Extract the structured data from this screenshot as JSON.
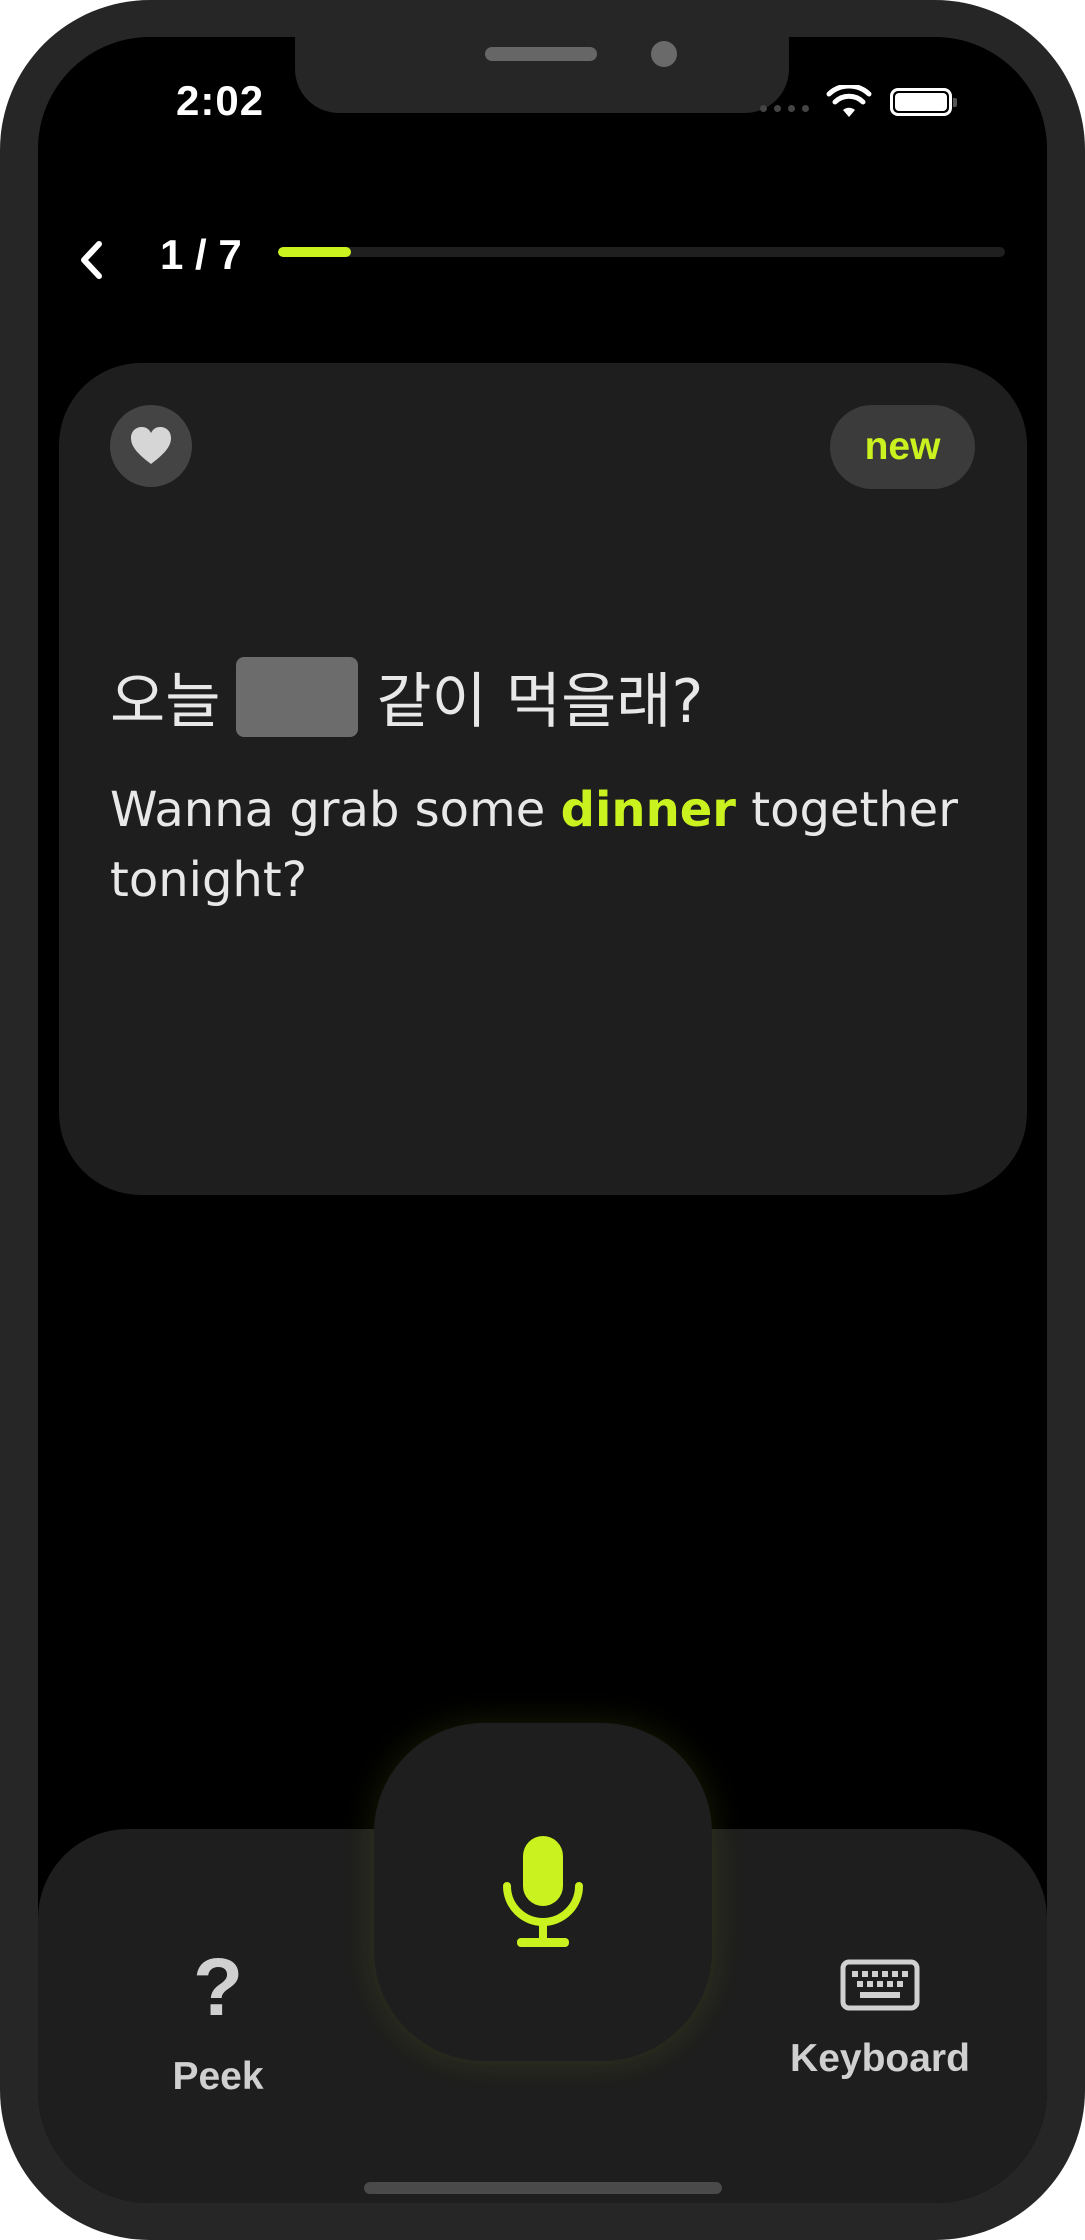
{
  "status_bar": {
    "time": "2:02"
  },
  "header": {
    "progress_label": "1 / 7",
    "progress_current": 1,
    "progress_total": 7,
    "progress_fraction": 0.1
  },
  "card": {
    "badge": "new",
    "korean_before": "오늘",
    "korean_after": "같이 먹을래?",
    "english_before": "Wanna grab some",
    "english_highlight": "dinner",
    "english_after": "together tonight?"
  },
  "controls": {
    "peek_label": "Peek",
    "peek_icon_glyph": "?",
    "keyboard_label": "Keyboard"
  },
  "icons": {
    "back": "chevron-left-icon",
    "favorite": "heart-icon",
    "mic": "microphone-icon",
    "peek": "question-mark-icon",
    "keyboard": "keyboard-icon",
    "wifi": "wifi-icon",
    "battery": "battery-icon"
  },
  "colors": {
    "accent": "#c9f21e",
    "background": "#000000",
    "card": "#1e1e1e",
    "frame": "#262626"
  }
}
